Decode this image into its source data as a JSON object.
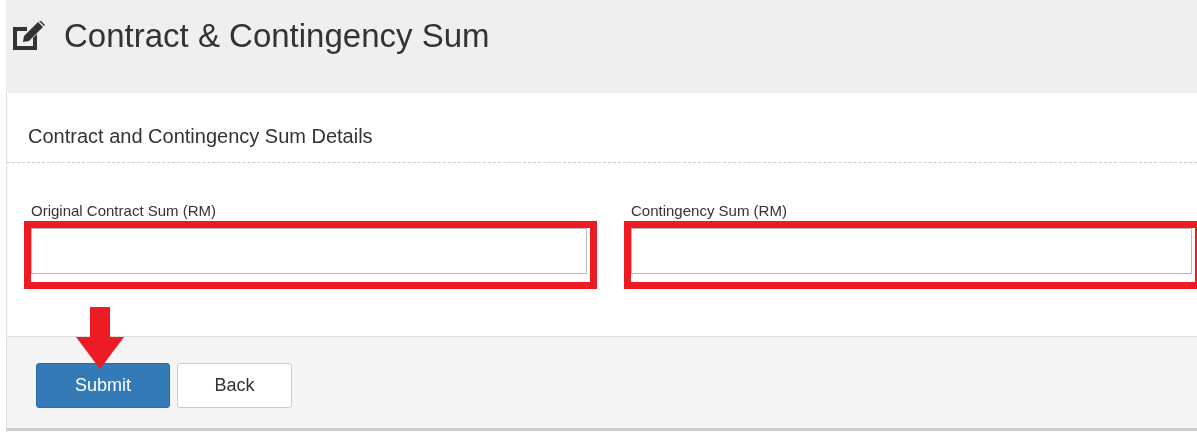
{
  "page_header": {
    "title": "Contract & Contingency Sum"
  },
  "panel": {
    "heading": "Contract and Contingency Sum Details",
    "fields": [
      {
        "label": "Original Contract Sum (RM)",
        "highlighted": true
      },
      {
        "label": "Contingency Sum (RM)",
        "highlighted": true
      }
    ],
    "buttons": [
      {
        "label": "Submit",
        "kind": "primary",
        "pointed_at": true
      },
      {
        "label": "Back",
        "kind": "default",
        "pointed_at": false
      }
    ]
  }
}
